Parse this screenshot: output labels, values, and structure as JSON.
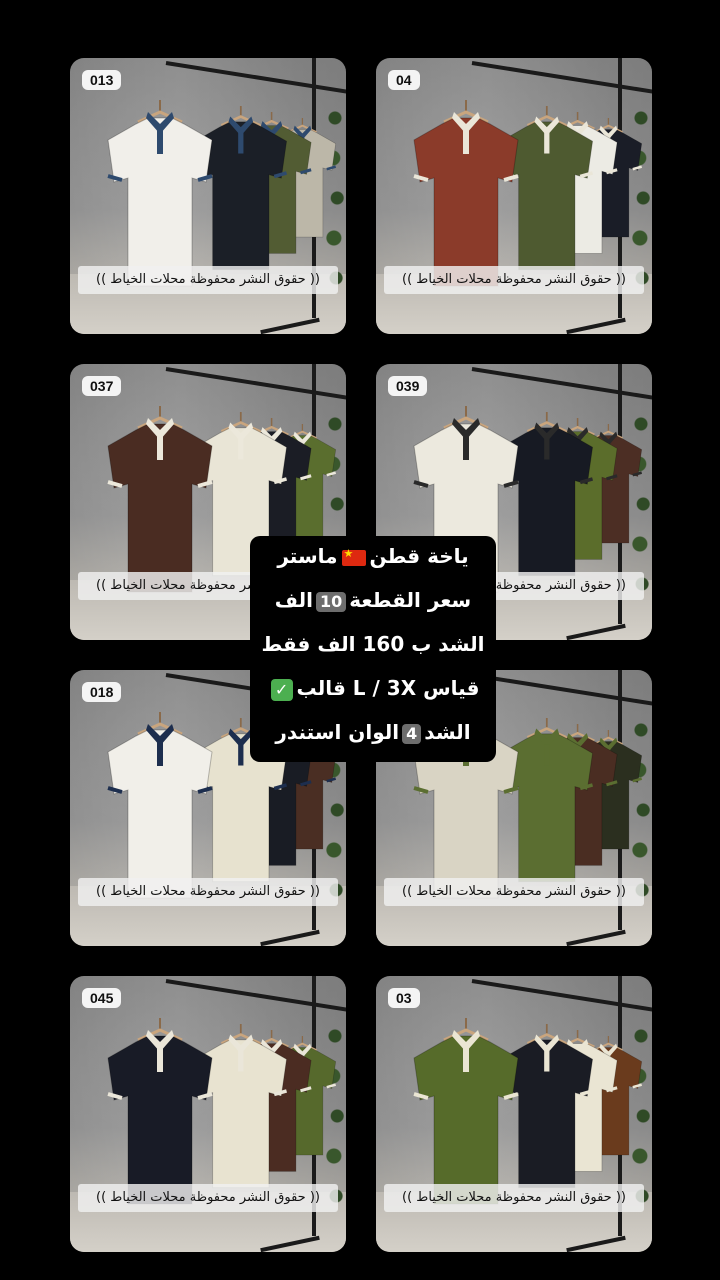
{
  "products": [
    {
      "code": "013",
      "caption": "(( حقوق النشر محفوظة محلات الخياط ))",
      "colors": [
        "#f1efea",
        "#1b1f27",
        "#525c33",
        "#bcb7a8"
      ],
      "trim": "#2e4a6e"
    },
    {
      "code": "04",
      "caption": "(( حقوق النشر محفوظة محلات الخياط ))",
      "colors": [
        "#8b3b2a",
        "#4e5a30",
        "#ecebe4",
        "#1a1d27"
      ],
      "trim": "#eae6d8"
    },
    {
      "code": "037",
      "caption": "(( حقوق النشر محفوظة محلات الخياط ))",
      "colors": [
        "#4a2c22",
        "#e9e5d6",
        "#1b1d25",
        "#5a6e2e"
      ],
      "trim": "#ece8db"
    },
    {
      "code": "039",
      "caption": "(( حقوق النشر محفوظة محلات الخياط ))",
      "colors": [
        "#ece9de",
        "#171a23",
        "#5b6d2b",
        "#4c2e24"
      ],
      "trim": "#2a2a2a"
    },
    {
      "code": "018",
      "caption": "(( حقوق النشر محفوظة محلات الخياط ))",
      "colors": [
        "#f1efe9",
        "#e7e2cf",
        "#191c24",
        "#4a2e23"
      ],
      "trim": "#1d2e4e"
    },
    {
      "code": "",
      "caption": "(( حقوق النشر محفوظة محلات الخياط ))",
      "colors": [
        "#d9d4c4",
        "#5b6e31",
        "#4a2d22",
        "#2b2f1f"
      ],
      "trim": "#5b6e31"
    },
    {
      "code": "045",
      "caption": "(( حقوق النشر محفوظة محلات الخياط ))",
      "colors": [
        "#181b26",
        "#e8e3d0",
        "#4b2c22",
        "#56692c"
      ],
      "trim": "#eae6d9"
    },
    {
      "code": "03",
      "caption": "(( حقوق النشر محفوظة محلات الخياط ))",
      "colors": [
        "#566b2a",
        "#1a1c24",
        "#eae5d3",
        "#6a3b1d"
      ],
      "trim": "#eae5d3"
    }
  ],
  "overlay": {
    "line1_text": "ياخة قطن",
    "line1_text2": "ماستر",
    "flag_icon": "china-flag-icon",
    "line2_text": "سعر القطعة",
    "line2_num": "10",
    "line2_text2": "الف",
    "line3": "الشد ب 160 الف فقط",
    "line4_text": "قياس L / 3X قالب",
    "check_icon": "check-mark-icon",
    "line5_text": "الشد",
    "line5_num": "4",
    "line5_text2": "الوان استندر"
  }
}
